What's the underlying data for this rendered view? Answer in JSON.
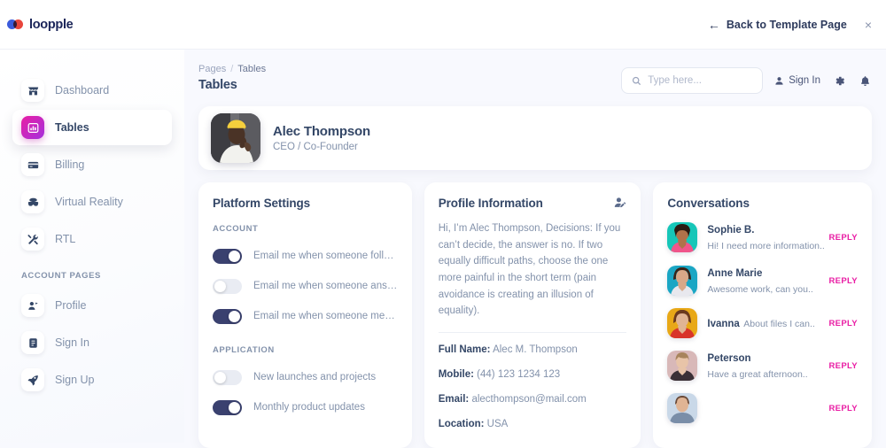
{
  "topbar": {
    "logo_text": "loopple",
    "back_label": "Back to Template Page",
    "back_arrow": "←",
    "close_label": "×"
  },
  "sidebar": {
    "items": [
      {
        "label": "Dashboard",
        "icon": "shop-icon",
        "active": false
      },
      {
        "label": "Tables",
        "icon": "table-chart-icon",
        "active": true
      },
      {
        "label": "Billing",
        "icon": "credit-card-icon",
        "active": false
      },
      {
        "label": "Virtual Reality",
        "icon": "vr-headset-icon",
        "active": false
      },
      {
        "label": "RTL",
        "icon": "tools-icon",
        "active": false
      }
    ],
    "section_title": "ACCOUNT PAGES",
    "account_items": [
      {
        "label": "Profile",
        "icon": "person-badge-icon"
      },
      {
        "label": "Sign In",
        "icon": "document-icon"
      },
      {
        "label": "Sign Up",
        "icon": "rocket-icon"
      }
    ]
  },
  "header": {
    "breadcrumb_root": "Pages",
    "breadcrumb_sep": "/",
    "breadcrumb_current": "Tables",
    "page_title": "Tables",
    "search_placeholder": "Type here...",
    "search_value": "",
    "signin_label": "Sign In",
    "gear_icon": "gear-icon",
    "bell_icon": "bell-icon",
    "search_icon": "search-icon"
  },
  "profile": {
    "name": "Alec Thompson",
    "role": "CEO / Co-Founder"
  },
  "platform_settings": {
    "title": "Platform Settings",
    "account_label": "ACCOUNT",
    "account_toggles": [
      {
        "label": "Email me when someone follows ...",
        "on": true
      },
      {
        "label": "Email me when someone answers...",
        "on": false
      },
      {
        "label": "Email me when someone mention...",
        "on": true
      }
    ],
    "application_label": "APPLICATION",
    "application_toggles": [
      {
        "label": "New launches and projects",
        "on": false
      },
      {
        "label": "Monthly product updates",
        "on": true
      }
    ]
  },
  "profile_information": {
    "title": "Profile Information",
    "edit_icon": "edit-user-icon",
    "bio": "Hi, I’m Alec Thompson, Decisions: If you can’t decide, the answer is no. If two equally difficult paths, choose the one more painful in the short term (pain avoidance is creating an illusion of equality).",
    "fields": [
      {
        "key": "Full Name:",
        "value": "Alec M. Thompson"
      },
      {
        "key": "Mobile:",
        "value": "(44) 123 1234 123"
      },
      {
        "key": "Email:",
        "value": "alecthompson@mail.com"
      },
      {
        "key": "Location:",
        "value": "USA"
      }
    ]
  },
  "conversations": {
    "title": "Conversations",
    "reply_label": "REPLY",
    "items": [
      {
        "name": "Sophie B.",
        "message": "Hi! I need more information..",
        "avatar_bg": "#16c6b8",
        "hair": "#2a1a12",
        "skin": "#b0724a",
        "cloth": "#f0558a"
      },
      {
        "name": "Anne Marie",
        "message": "Awesome work, can you..",
        "avatar_bg": "#1aa6c4",
        "hair": "#3a2418",
        "skin": "#d8a888",
        "cloth": "#e8e8ee"
      },
      {
        "name": "Ivanna",
        "message": "About files I can..",
        "avatar_bg": "#e8a817",
        "hair": "#6b3a1e",
        "skin": "#e0b494",
        "cloth": "#d8342a"
      },
      {
        "name": "Peterson",
        "message": "Have a great afternoon..",
        "avatar_bg": "#d8b8b8",
        "hair": "#a8845c",
        "skin": "#e8c4a8",
        "cloth": "#3a3036"
      },
      {
        "name": "",
        "message": "",
        "avatar_bg": "#c9d8e8",
        "hair": "#6a4a38",
        "skin": "#e0b494",
        "cloth": "#7a8ea8"
      }
    ]
  },
  "colors": {
    "accent_pink": "#e91ea4",
    "accent_purple": "#a431dd",
    "ink": "#344767",
    "muted": "#8392ab",
    "page_bg": "#f8f9fe"
  }
}
